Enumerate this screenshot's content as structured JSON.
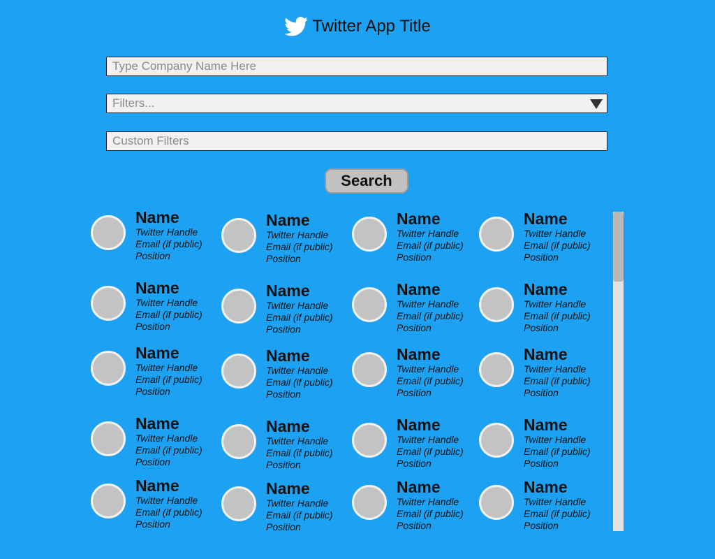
{
  "header": {
    "title": "Twitter App Title",
    "icon": "twitter-bird-icon"
  },
  "search": {
    "company_placeholder": "Type Company Name Here",
    "filters_placeholder": "Filters...",
    "custom_filters_placeholder": "Custom Filters",
    "button_label": "Search"
  },
  "card_template": {
    "name": "Name",
    "handle": "Twitter Handle",
    "email": "Email (if public)",
    "position": "Position"
  },
  "results_count": 20,
  "columns": 4,
  "colors": {
    "background": "#1da1f2",
    "avatar": "#c3c3c3",
    "field": "#f2f0f2",
    "button": "#c2c2c2"
  }
}
